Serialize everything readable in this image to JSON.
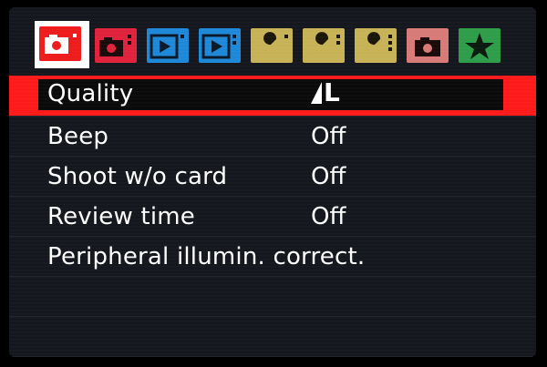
{
  "tabs": [
    {
      "name": "shooting-tab-1",
      "icon": "camera-icon",
      "color": "#ee1c1c",
      "active": true
    },
    {
      "name": "shooting-tab-2",
      "icon": "camera-icon",
      "color": "#e0223c",
      "active": false
    },
    {
      "name": "playback-tab-1",
      "icon": "playback-icon",
      "color": "#1e88d8",
      "active": false
    },
    {
      "name": "playback-tab-2",
      "icon": "playback-icon",
      "color": "#1e88d8",
      "active": false
    },
    {
      "name": "setup-tab-1",
      "icon": "wrench-icon",
      "color": "#c7b256",
      "active": false
    },
    {
      "name": "setup-tab-2",
      "icon": "wrench-icon",
      "color": "#c7b256",
      "active": false
    },
    {
      "name": "setup-tab-3",
      "icon": "wrench-icon",
      "color": "#c7b256",
      "active": false
    },
    {
      "name": "custom-tab",
      "icon": "camera-icon",
      "color": "#d87a78",
      "active": false
    },
    {
      "name": "my-menu-tab",
      "icon": "star-icon",
      "color": "#2e9d4a",
      "active": false
    }
  ],
  "menu": {
    "items": [
      {
        "label": "Quality",
        "value": "L",
        "value_icon": "quality-wedge-icon",
        "selected": true
      },
      {
        "label": "Beep",
        "value": "Off"
      },
      {
        "label": "Shoot w/o card",
        "value": "Off"
      },
      {
        "label": "Review time",
        "value": "Off"
      },
      {
        "label": "Peripheral illumin. correct.",
        "value": ""
      }
    ]
  },
  "colors": {
    "selection": "#ff1a1a",
    "background": "#14171d",
    "text": "#ffffff"
  }
}
